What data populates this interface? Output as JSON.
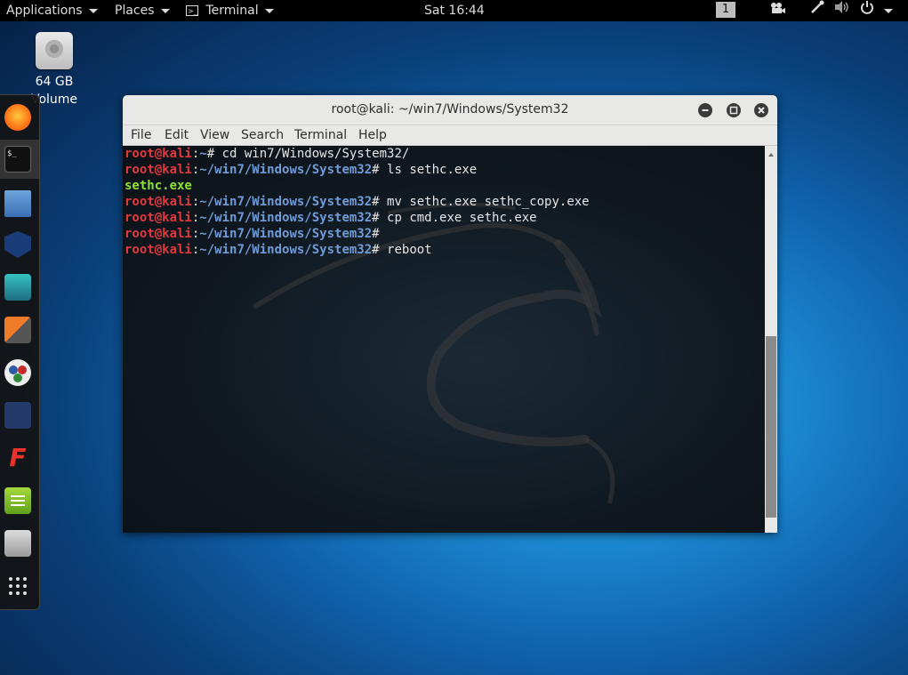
{
  "topbar": {
    "applications": "Applications",
    "places": "Places",
    "terminal": "Terminal",
    "clock": "Sat 16:44",
    "workspace": "1"
  },
  "desktop": {
    "volume_label_line1": "64 GB",
    "volume_label_line2": "Volume"
  },
  "dock": {
    "items": [
      "firefox-icon",
      "terminal-icon",
      "files-icon",
      "metasploit-icon",
      "armitage-icon",
      "burpsuite-icon",
      "maltego-icon",
      "beef-icon",
      "faraday-icon",
      "leafpad-icon",
      "cherrytree-icon",
      "show-apps-icon"
    ]
  },
  "window": {
    "title": "root@kali: ~/win7/Windows/System32",
    "menu": [
      "File",
      "Edit",
      "View",
      "Search",
      "Terminal",
      "Help"
    ]
  },
  "terminal": {
    "lines": [
      {
        "user": "root@kali",
        "sep": ":",
        "path": "~",
        "cmd": "# cd win7/Windows/System32/"
      },
      {
        "user": "root@kali",
        "sep": ":",
        "path": "~/win7/Windows/System32",
        "cmd": "# ls sethc.exe"
      },
      {
        "output": "sethc.exe"
      },
      {
        "user": "root@kali",
        "sep": ":",
        "path": "~/win7/Windows/System32",
        "cmd": "# mv sethc.exe sethc_copy.exe"
      },
      {
        "user": "root@kali",
        "sep": ":",
        "path": "~/win7/Windows/System32",
        "cmd": "# cp cmd.exe sethc.exe"
      },
      {
        "user": "root@kali",
        "sep": ":",
        "path": "~/win7/Windows/System32",
        "cmd": "#"
      },
      {
        "user": "root@kali",
        "sep": ":",
        "path": "~/win7/Windows/System32",
        "cmd": "# reboot"
      }
    ]
  },
  "colors": {
    "prompt_user": "#e0393e",
    "prompt_path": "#6f9bd8",
    "file_output": "#8ae234"
  }
}
